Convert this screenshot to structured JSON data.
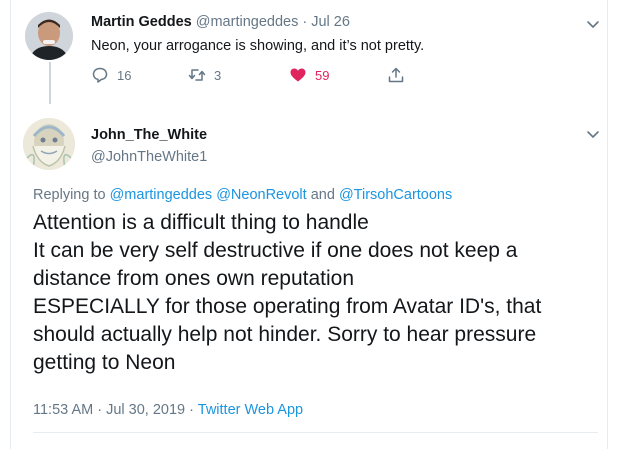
{
  "reply_tweet": {
    "author_name": "Martin Geddes",
    "handle": "@martingeddes",
    "separator": "·",
    "date": "Jul 26",
    "text": "Neon, your arrogance is showing, and it’s not pretty.",
    "reply_count": "16",
    "retweet_count": "3",
    "like_count": "59",
    "liked": true,
    "like_color": "#e0245e"
  },
  "main_tweet": {
    "author_name": "John_The_White",
    "handle": "@JohnTheWhite1",
    "replying_prefix": "Replying to",
    "mention_1": "@martingeddes",
    "mention_2": "@NeonRevolt",
    "mention_joiner": "and",
    "mention_3": "@TirsohCartoons",
    "lines": [
      "Attention is a difficult thing to handle",
      "It can be very self destructive if one does not keep a",
      "distance from ones own reputation",
      "ESPECIALLY for those operating from Avatar ID's, that",
      "should actually help not hinder. Sorry to hear pressure",
      "getting to Neon"
    ],
    "time": "11:53 AM",
    "date": "Jul 30, 2019",
    "separator": "·",
    "source": "Twitter Web App"
  },
  "colors": {
    "link": "#1b95e0",
    "muted": "#657786",
    "text": "#14171a"
  },
  "icons": [
    "reply-icon",
    "retweet-icon",
    "heart-icon",
    "share-icon",
    "chevron-down-icon"
  ]
}
